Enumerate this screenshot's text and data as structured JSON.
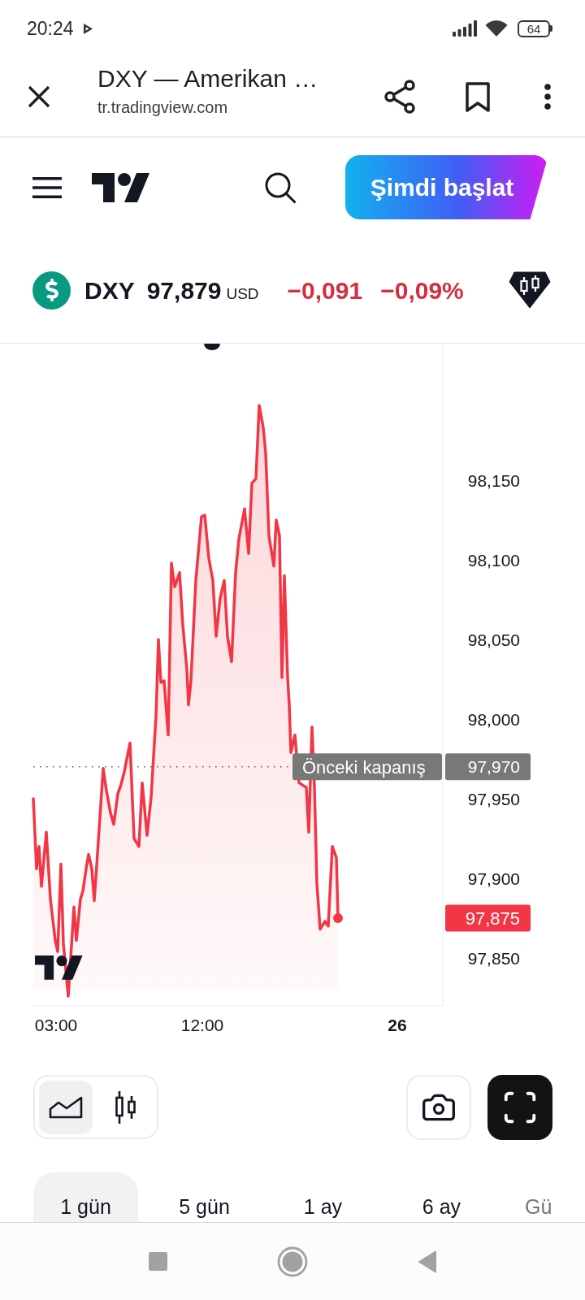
{
  "status_bar": {
    "time": "20:24",
    "battery": "64"
  },
  "browser_bar": {
    "title": "DXY — Amerikan …",
    "url": "tr.tradingview.com"
  },
  "header": {
    "cta_button": "Şimdi başlat"
  },
  "symbol": {
    "ticker": "DXY",
    "price": "97,879",
    "currency": "USD",
    "change": "−0,091",
    "change_percent": "−0,09%",
    "falling": true
  },
  "chart": {
    "chart_data": {
      "type": "area",
      "x": [
        1.6,
        1.8,
        1.95,
        2.1,
        2.4,
        2.65,
        2.95,
        3.1,
        3.3,
        3.45,
        3.75,
        4.1,
        4.25,
        4.5,
        4.65,
        4.85,
        5.0,
        5.2,
        5.35,
        5.5,
        5.9,
        6.1,
        6.35,
        6.55,
        6.8,
        7.0,
        7.2,
        7.55,
        7.8,
        8.1,
        8.3,
        8.6,
        8.85,
        9.15,
        9.3,
        9.45,
        9.65,
        9.9,
        10.1,
        10.3,
        10.6,
        10.8,
        11.05,
        11.15,
        11.3,
        11.6,
        11.95,
        12.15,
        12.4,
        12.65,
        12.85,
        13.1,
        13.35,
        13.55,
        13.8,
        14.05,
        14.25,
        14.6,
        14.85,
        15.05,
        15.3,
        15.5,
        15.75,
        15.9,
        16.1,
        16.4,
        16.55,
        16.75,
        16.9,
        17.05,
        17.25,
        17.35,
        17.45,
        17.7,
        17.95,
        18.4,
        18.55,
        18.75,
        18.9,
        19.05,
        19.25,
        19.55,
        19.75,
        20.0,
        20.25,
        20.35
      ],
      "series": [
        {
          "color": "#f23645",
          "values": [
            97.95,
            97.906,
            97.92,
            97.895,
            97.929,
            97.887,
            97.861,
            97.854,
            97.909,
            97.859,
            97.826,
            97.882,
            97.861,
            97.887,
            97.892,
            97.906,
            97.915,
            97.906,
            97.886,
            97.908,
            97.969,
            97.955,
            97.941,
            97.934,
            97.953,
            97.959,
            97.967,
            97.985,
            97.925,
            97.92,
            97.96,
            97.927,
            97.951,
            98.002,
            98.05,
            98.023,
            98.024,
            97.99,
            98.098,
            98.083,
            98.092,
            98.059,
            98.031,
            98.009,
            98.024,
            98.087,
            98.127,
            98.128,
            98.101,
            98.087,
            98.052,
            98.076,
            98.087,
            98.052,
            98.036,
            98.092,
            98.113,
            98.132,
            98.104,
            98.148,
            98.151,
            98.197,
            98.183,
            98.167,
            98.115,
            98.096,
            98.125,
            98.115,
            98.026,
            98.09,
            98.026,
            98.009,
            97.979,
            97.99,
            97.96,
            97.957,
            97.929,
            97.995,
            97.957,
            97.897,
            97.868,
            97.873,
            97.87,
            97.92,
            97.913,
            97.875
          ]
        }
      ],
      "xlim": [
        1.6,
        26.8
      ],
      "ylim": [
        97.82,
        98.235
      ],
      "xticks": [
        {
          "value": 3,
          "label": "03:00"
        },
        {
          "value": 12,
          "label": "12:00"
        }
      ],
      "yticks": [
        {
          "value": 98.15,
          "label": "98,150"
        },
        {
          "value": 98.1,
          "label": "98,100"
        },
        {
          "value": 98.05,
          "label": "98,050"
        },
        {
          "value": 98.0,
          "label": "98,000"
        },
        {
          "value": 97.97,
          "label": "97,970"
        },
        {
          "value": 97.95,
          "label": "97,950"
        },
        {
          "value": 97.9,
          "label": "97,900"
        },
        {
          "value": 97.85,
          "label": "97,850"
        }
      ],
      "ref_lines": [
        {
          "axis": "y",
          "value": 97.97,
          "label": "Önceki kapanış"
        }
      ]
    },
    "day_label": "26",
    "last_price_tag": "97,875"
  },
  "chart_types": [
    {
      "kind": "area",
      "selected": true
    },
    {
      "kind": "candles",
      "selected": false
    }
  ],
  "timeframes": [
    {
      "label": "1 gün",
      "selected": true
    },
    {
      "label": "5 gün",
      "selected": false
    },
    {
      "label": "1 ay",
      "selected": false
    },
    {
      "label": "6 ay",
      "selected": false
    },
    {
      "label": "Gü",
      "selected": false
    }
  ]
}
